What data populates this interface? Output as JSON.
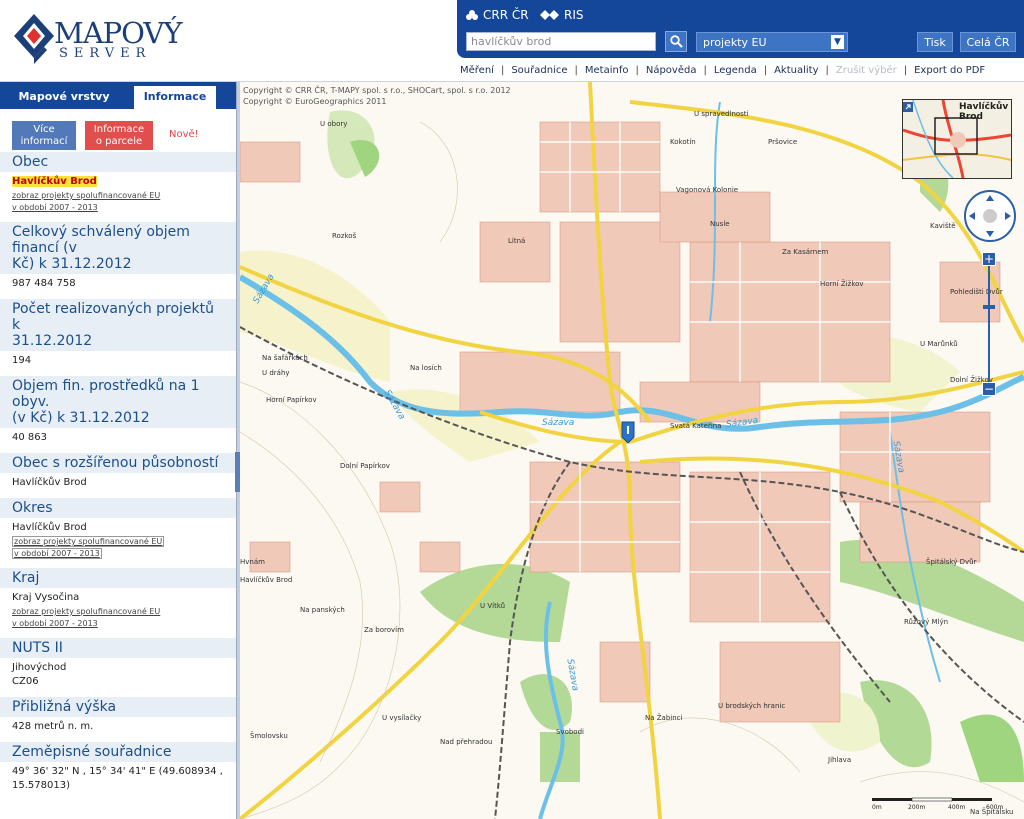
{
  "logo": {
    "word1": "MAPOVÝ",
    "word2": "SERVER"
  },
  "top_links": {
    "crr": "CRR ČR",
    "ris": "RIS"
  },
  "search": {
    "value": "havlíčkův brod"
  },
  "theme_select": {
    "value": "projekty EU"
  },
  "top_buttons": {
    "print": "Tisk",
    "full": "Celá ČR"
  },
  "menu": [
    {
      "label": "Měření",
      "disabled": false
    },
    {
      "label": "Souřadnice",
      "disabled": false
    },
    {
      "label": "Metainfo",
      "disabled": false
    },
    {
      "label": "Nápověda",
      "disabled": false
    },
    {
      "label": "Legenda",
      "disabled": false
    },
    {
      "label": "Aktuality",
      "disabled": false
    },
    {
      "label": "Zrušit výběr",
      "disabled": true
    },
    {
      "label": "Export do PDF",
      "disabled": false
    }
  ],
  "tabs": {
    "layers": "Mapové vrstvy",
    "info": "Informace"
  },
  "panel_buttons": {
    "more_l1": "Více",
    "more_l2": "informací",
    "parcel_l1": "Informace",
    "parcel_l2": "o parcele",
    "new": "Nově!"
  },
  "info": {
    "obec_h": "Obec",
    "obec_v": "Havlíčkův Brod",
    "link_l1": "zobraz projekty spolufinancované EU",
    "link_l2": "v období 2007 - 2013",
    "fin_h1": "Celkový schválený objem financí (v",
    "fin_h2": "Kč) k 31.12.2012",
    "fin_v": "987 484 758",
    "proj_h1": "Počet realizovaných projektů k",
    "proj_h2": "31.12.2012",
    "proj_v": "194",
    "perc_h1": "Objem fin. prostředků na 1 obyv.",
    "perc_h2": "(v Kč) k 31.12.2012",
    "perc_v": "40 863",
    "orp_h": "Obec s rozšířenou působností",
    "orp_v": "Havlíčkův Brod",
    "okres_h": "Okres",
    "okres_v": "Havlíčkův Brod",
    "kraj_h": "Kraj",
    "kraj_v": "Kraj Vysočina",
    "nuts_h": "NUTS II",
    "nuts_v1": "Jihovýchod",
    "nuts_v2": "CZ06",
    "vyska_h": "Přibližná výška",
    "vyska_v": "428 metrů n. m.",
    "gps_h": "Zeměpisné souřadnice",
    "gps_v1": "49° 36' 32\" N , 15° 34' 41\" E (49.608934 ,",
    "gps_v2": "15.578013)"
  },
  "map": {
    "copyright_l1": "Copyright © CRR ČR, T-MAPY spol. s r.o., SHOCart, spol. s r.o. 2012",
    "copyright_l2": "Copyright © EuroGeographics 2011",
    "overview_l1": "Havlíčkův",
    "overview_l2": "Brod",
    "scale_0": "0m",
    "scale_1": "200m",
    "scale_2": "400m",
    "scale_3": "600m",
    "zoom_in": "+",
    "zoom_out": "−",
    "labels": {
      "u_obory": "U obory",
      "u_spravedlnosti": "U spravedlnosti",
      "kokotin": "Kokotín",
      "prsovice": "Pršovice",
      "vagonova": "Vagonová Kolonie",
      "nusle": "Nusle",
      "kaviste": "Kaviště",
      "za_kasarnem": "Za Kasárnem",
      "horni_zizkov": "Horní Žižkov",
      "pohledisti": "Pohledišti Dvůr",
      "u_marunku": "U Marůnků",
      "dolni_zizkov": "Dolní Žižkov",
      "rozkos": "Rozkoš",
      "litna": "Litná",
      "na_safarkach": "Na šafářkách",
      "u_drahy": "U dráhy",
      "na_losich": "Na losích",
      "horni_papirkov": "Horní Papírkov",
      "dolni_papirkov": "Dolní Papírkov",
      "sazava1": "Sázava",
      "sazava2": "Sázava",
      "sazava3": "Sázava",
      "sazava4": "Sázava",
      "sazava5": "Sázava",
      "sazava6": "Sázava",
      "svata_katerina": "Svatá Kateřina",
      "hvnam": "Hvnám",
      "hb_small": "Havlíčkův Brod",
      "na_panskych": "Na panských",
      "za_borovim": "Za borovím",
      "u_vitku": "U Vítků",
      "spitalsky": "Špitálský Dvůr",
      "ruzovy_mlyn": "Růžový Mlýn",
      "u_vysilacky": "U vysílačky",
      "na_zabinci": "Na Žabinci",
      "u_brodskych": "U brodských hranic",
      "sm_bosovu": "Šmolovsku",
      "nad_prehradou": "Nad přehradou",
      "svobodi": "Svobodi",
      "jihlava": "Jihlava",
      "na_spitalsku": "Na Špitálsku"
    }
  }
}
